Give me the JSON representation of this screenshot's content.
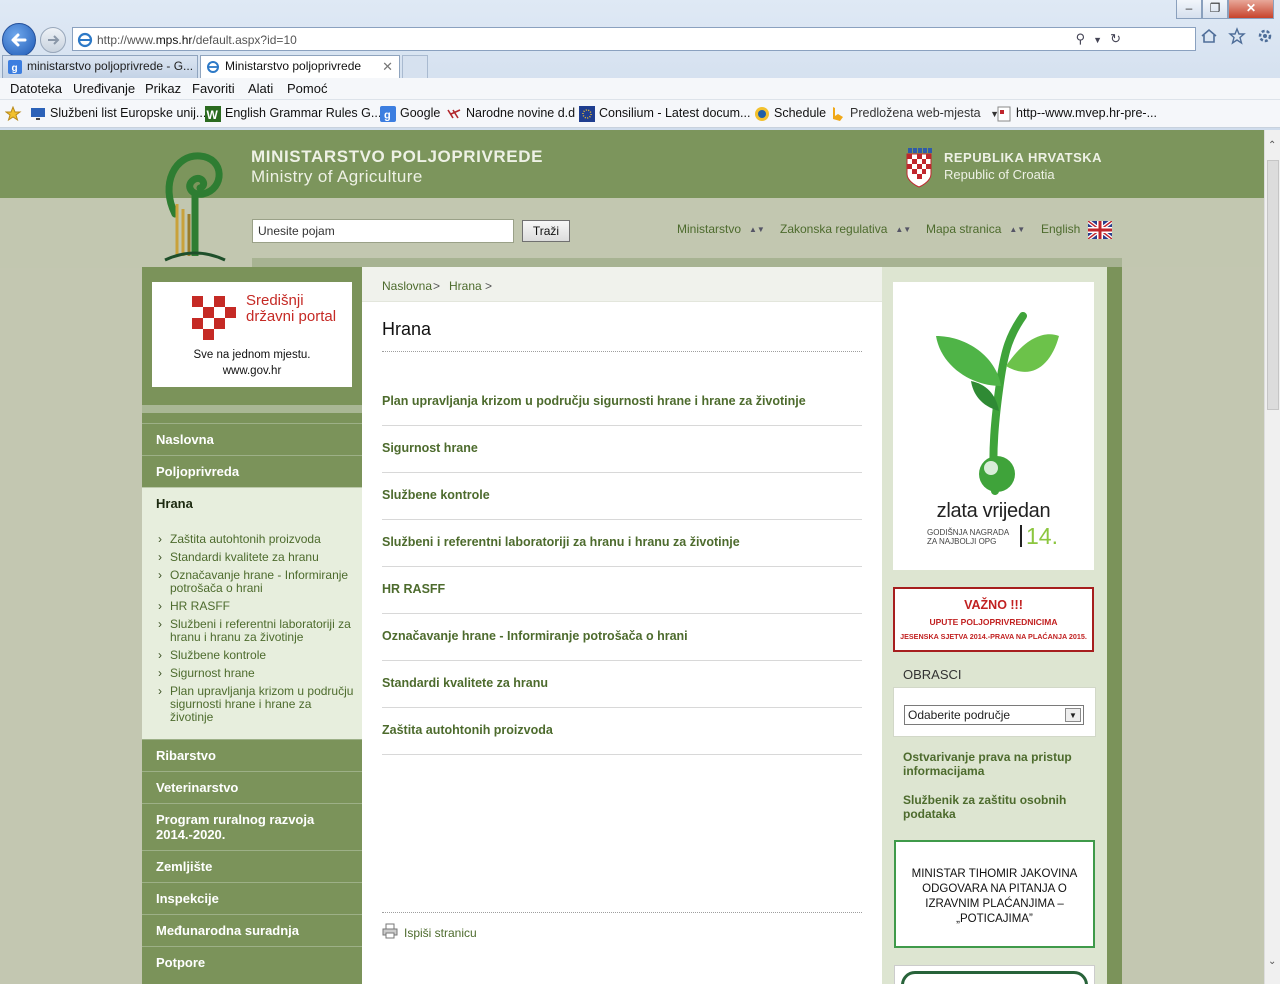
{
  "browser": {
    "address": {
      "prefix": "http://www.",
      "domain": "mps.hr",
      "path": "/default.aspx?id=10"
    },
    "tabs": [
      {
        "label": "ministarstvo poljoprivrede - G..."
      },
      {
        "label": "Ministarstvo poljoprivrede"
      }
    ],
    "menu": [
      "Datoteka",
      "Uređivanje",
      "Prikaz",
      "Favoriti",
      "Alati",
      "Pomoć"
    ],
    "favorites": [
      "Službeni list Europske unij...",
      "English Grammar Rules G...",
      "Google",
      "Narodne novine d.d",
      "Consilium - Latest docum...",
      "Schedule",
      "Predložena web-mjesta",
      "http--www.mvep.hr-pre-..."
    ]
  },
  "site": {
    "title_hr": "MINISTARSTVO POLJOPRIVREDE",
    "title_en": "Ministry of Agriculture",
    "republic_hr": "REPUBLIKA HRVATSKA",
    "republic_en": "Republic of Croatia",
    "search_placeholder": "Unesite pojam",
    "search_button": "Traži",
    "top_nav": [
      "Ministarstvo",
      "Zakonska regulativa",
      "Mapa stranica",
      "English"
    ]
  },
  "portal": {
    "title": "Središnji državni portal",
    "slogan": "Sve na jednom mjestu.",
    "url": "www.gov.hr"
  },
  "sidenav": {
    "items_before": [
      "Naslovna",
      "Poljoprivreda"
    ],
    "active": "Hrana",
    "subitems": [
      "Zaštita autohtonih proizvoda",
      "Standardi kvalitete za hranu",
      "Označavanje hrane - Informiranje potrošača o hrani",
      "HR RASFF",
      "Službeni i referentni laboratoriji za hranu i hranu za životinje",
      "Službene kontrole",
      "Sigurnost hrane",
      "Plan upravljanja krizom u području sigurnosti hrane i hrane za životinje"
    ],
    "items_after": [
      "Ribarstvo",
      "Veterinarstvo",
      "Program ruralnog razvoja 2014.-2020.",
      "Zemljište",
      "Inspekcije",
      "Međunarodna suradnja",
      "Potpore"
    ]
  },
  "content": {
    "breadcrumb": [
      "Naslovna",
      "Hrana"
    ],
    "breadcrumb_sep": ">",
    "title": "Hrana",
    "articles": [
      "Plan upravljanja krizom u području sigurnosti hrane i hrane za životinje",
      "Sigurnost hrane",
      "Službene kontrole",
      "Službeni i referentni laboratoriji za hranu i hranu za životinje",
      "HR RASFF",
      "Označavanje hrane - Informiranje potrošača o hrani",
      "Standardi kvalitete za hranu",
      "Zaštita autohtonih proizvoda"
    ],
    "print_label": "Ispiši stranicu"
  },
  "right": {
    "award_title": "zlata vrijedan",
    "award_sub": "GODIŠNJA NAGRADA ZA NAJBOLJI OPG",
    "award_year": "14.",
    "important_title": "VAŽNO !!!",
    "important_sub": "UPUTE POLJOPRIVREDNICIMA",
    "important_sub2": "JESENSKA SJETVA 2014.-PRAVA NA PLAĆANJA 2015.",
    "forms_title": "OBRASCI",
    "forms_select": "Odaberite područje",
    "link_access": "Ostvarivanje prava na pristup informacijama",
    "link_privacy": "Službenik za zaštitu osobnih podataka",
    "minister_text": "MINISTAR TIHOMIR JAKOVINA ODGOVARA NA PITANJA O IZRAVNIM PLAĆANJIMA – „POTICAJIMA”"
  },
  "colors": {
    "header_green": "#7c955c",
    "link_green": "#4d6b2d",
    "alert_red": "#c12121"
  }
}
